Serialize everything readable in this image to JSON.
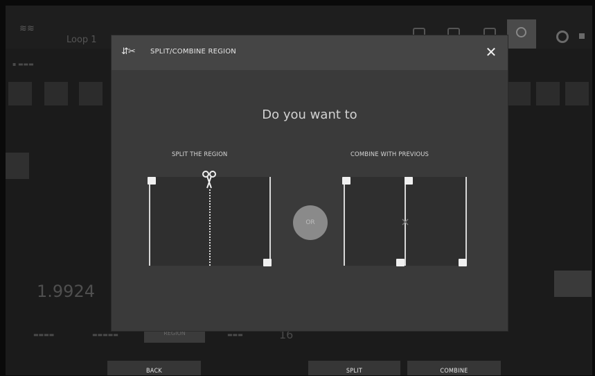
{
  "background": {
    "app_title": "Loop 1",
    "big_readout": "1.9924",
    "tab_active": "REGION",
    "counter": "16"
  },
  "dialog": {
    "title": "SPLIT/COMBINE REGION",
    "question": "Do you want to",
    "split_label": "SPLIT THE REGION",
    "combine_label": "COMBINE WITH PREVIOUS",
    "or_label": "OR",
    "close_glyph": "✕"
  },
  "bottom_bar": {
    "back": "BACK",
    "split": "SPLIT",
    "combine": "COMBINE"
  },
  "icons": {
    "header": "split-combine-icon",
    "scissors": "scissors-icon",
    "combine": "combine-x-icon"
  },
  "colors": {
    "dialog_bg": "#3a3a3a",
    "header_bg": "#454545",
    "region_bg": "#2f2f2f",
    "handle": "#f0f0f0",
    "or_circle": "#8a8a8a"
  }
}
